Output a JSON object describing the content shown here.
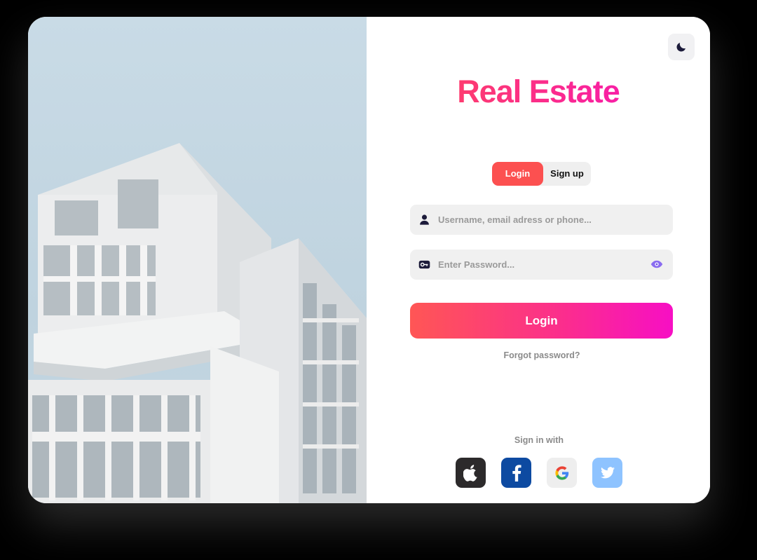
{
  "brand": {
    "title": "Real Estate",
    "gradient_from": "#ff4c54",
    "gradient_to": "#f40fc6"
  },
  "theme_toggle": {
    "icon": "moon-icon"
  },
  "tabs": [
    {
      "label": "Login",
      "active": true
    },
    {
      "label": "Sign up",
      "active": false
    }
  ],
  "form": {
    "username": {
      "placeholder": "Username, email adress or phone...",
      "value": "",
      "icon": "user-icon"
    },
    "password": {
      "placeholder": "Enter Password...",
      "value": "",
      "icon": "key-icon",
      "toggle_icon": "eye-icon"
    },
    "submit_label": "Login",
    "forgot_label": "Forgot password?"
  },
  "social": {
    "heading": "Sign in with",
    "providers": [
      {
        "name": "apple",
        "icon": "apple-icon",
        "color": "#2c2a2b"
      },
      {
        "name": "facebook",
        "icon": "facebook-icon",
        "color": "#0d4aa1"
      },
      {
        "name": "google",
        "icon": "google-icon",
        "color": "#eeeeee"
      },
      {
        "name": "twitter",
        "icon": "twitter-icon",
        "color": "#8ec3ff"
      }
    ]
  },
  "colors": {
    "accent": "#fc5050",
    "tab_bg": "#efefef",
    "field_bg": "#f0f0f0",
    "muted_text": "#8b8b8b"
  }
}
